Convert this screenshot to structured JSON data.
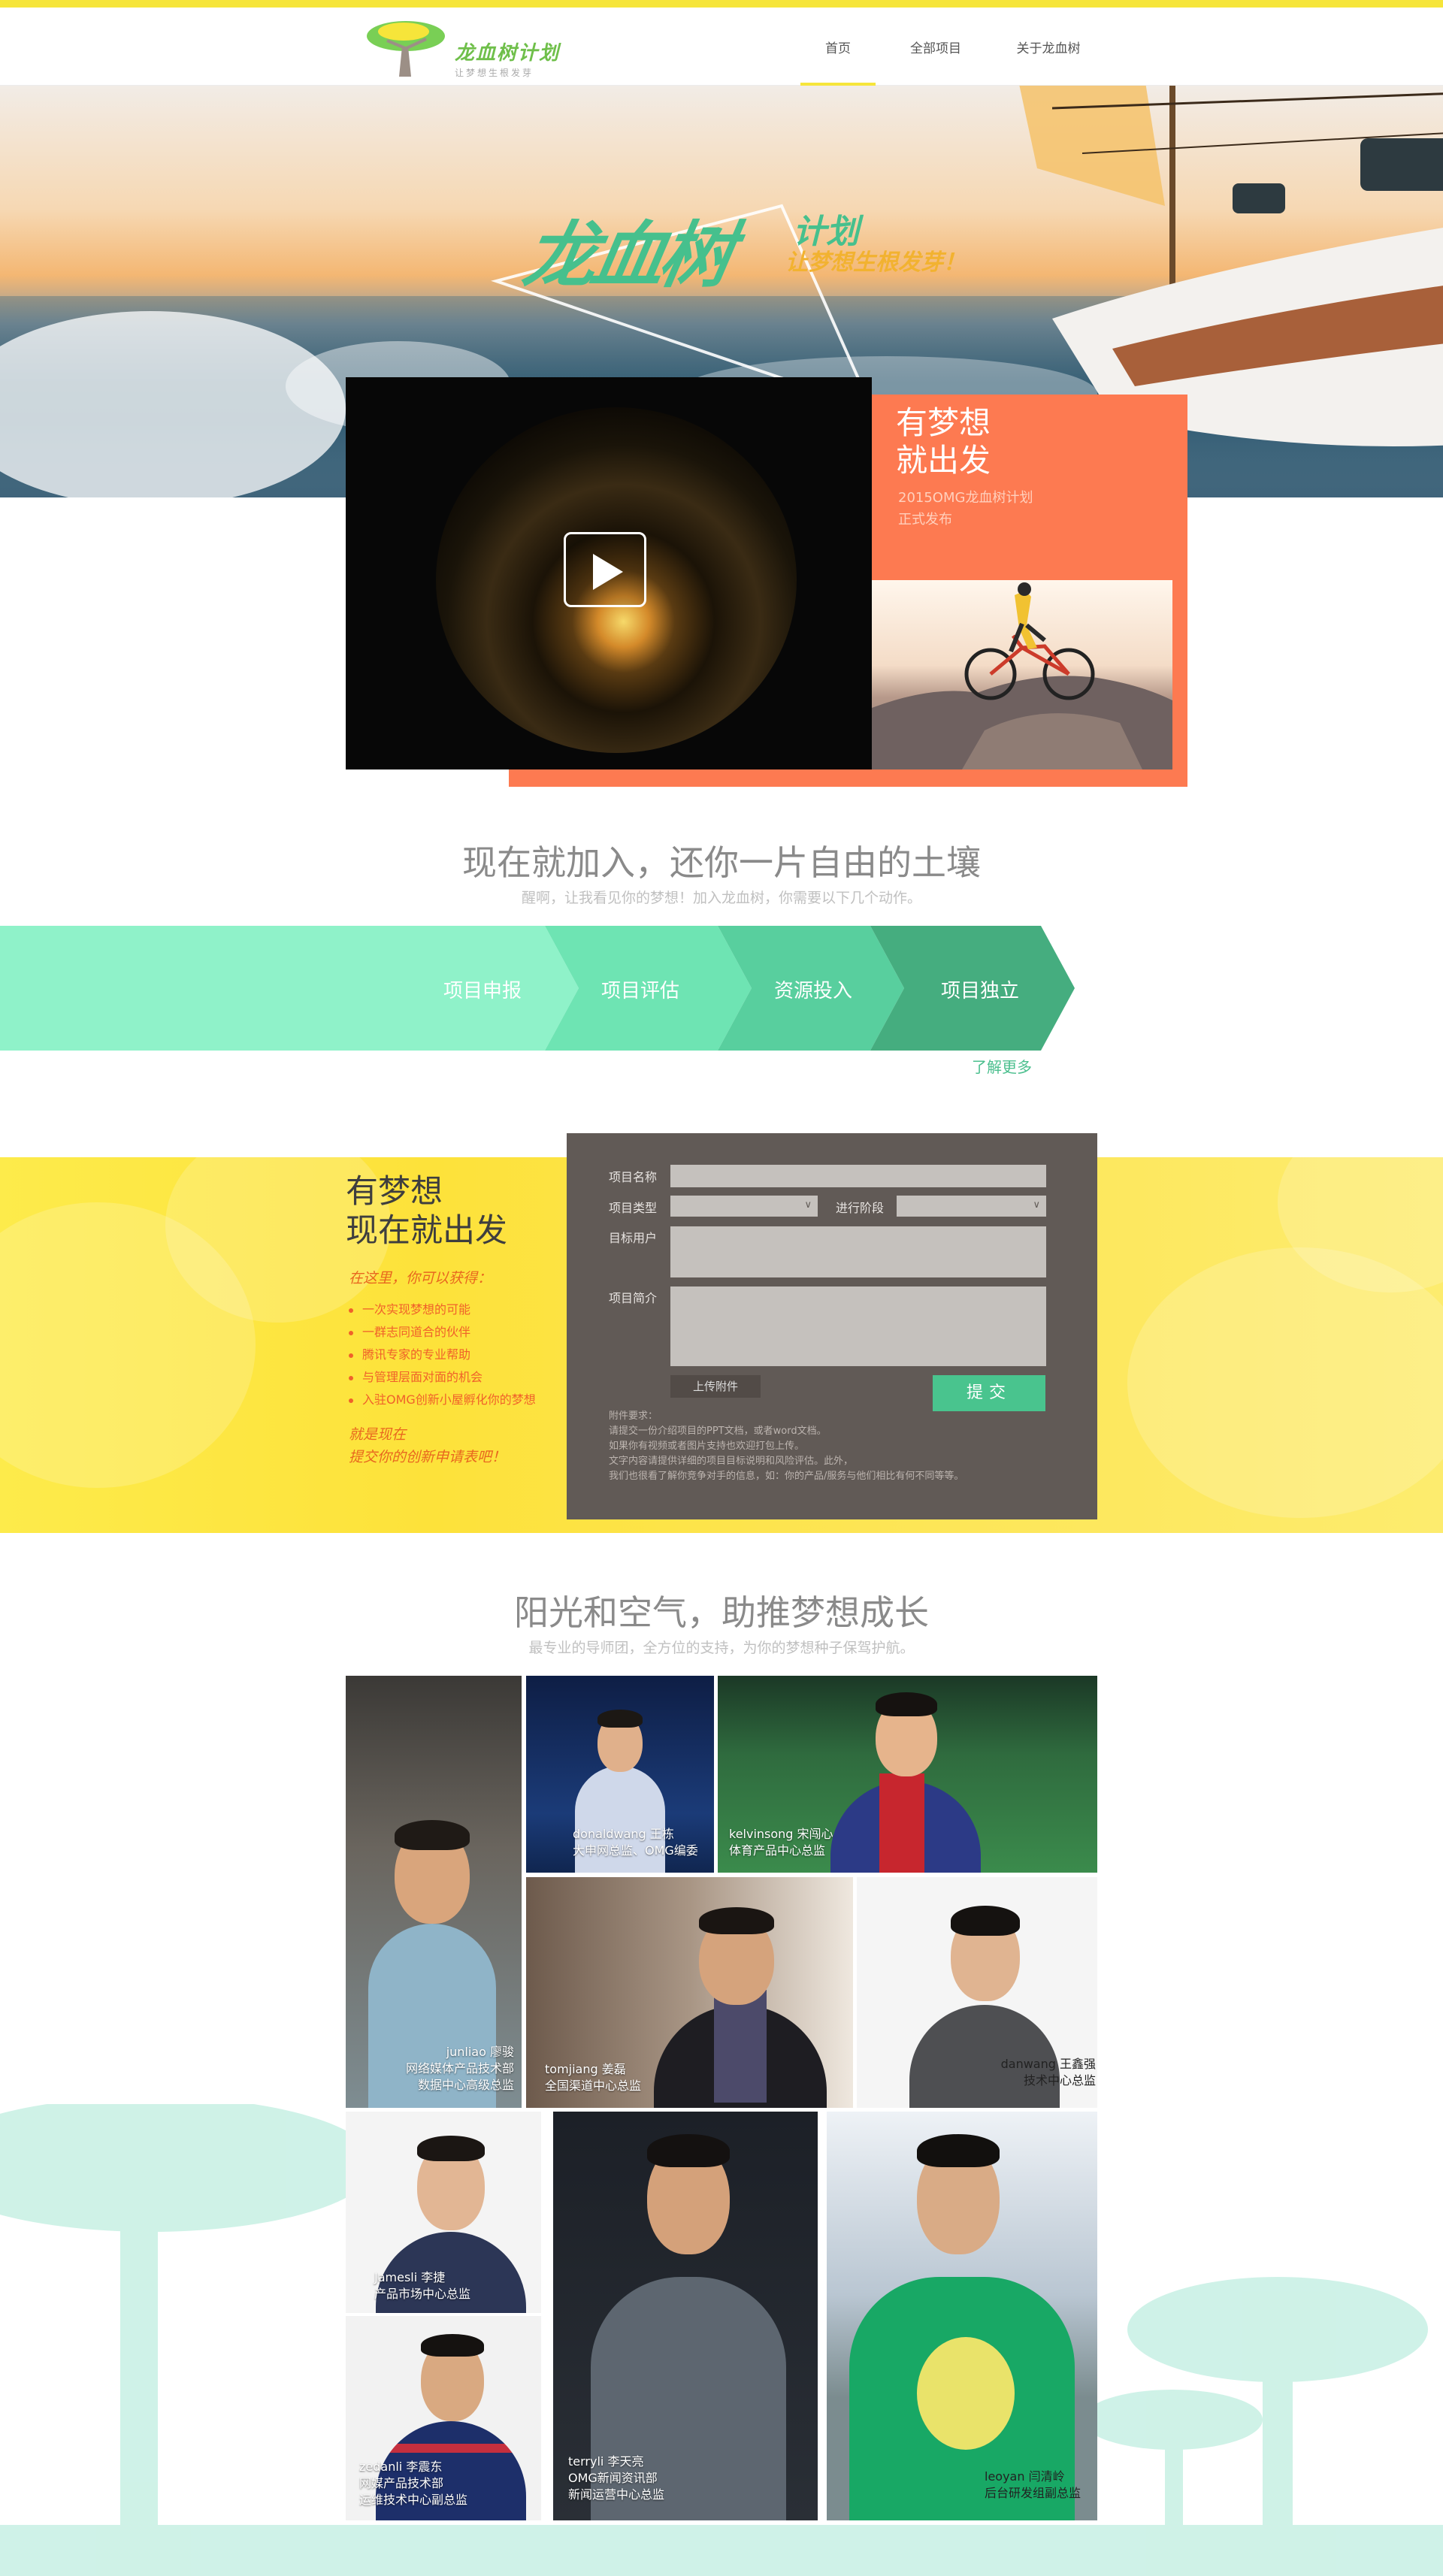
{
  "brand": {
    "name": "龙血树计划",
    "tagline": "让梦想生根发芽",
    "accent": "#f6e53a",
    "green": "#46c08d",
    "orange": "#fd7a51"
  },
  "nav": {
    "items": [
      {
        "label": "首页",
        "active": true
      },
      {
        "label": "全部项目",
        "active": false
      },
      {
        "label": "关于龙血树",
        "active": false
      }
    ]
  },
  "hero": {
    "title_main": "龙血树",
    "title_small": "计划",
    "slogan": "让梦想生根发芽！"
  },
  "feature": {
    "title_line1": "有梦想",
    "title_line2": "就出发",
    "sub_line1": "2015OMG龙血树计划",
    "sub_line2": "正式发布",
    "play_icon": "play-icon"
  },
  "join": {
    "title": "现在就加入，还你一片自由的土壤",
    "subtitle": "醒啊，让我看见你的梦想！加入龙血树，你需要以下几个动作。",
    "steps": [
      "项目申报",
      "项目评估",
      "资源投入",
      "项目独立"
    ],
    "step_colors": [
      "#8ff2c9",
      "#6ee4b3",
      "#58cf9e",
      "#45ad7f"
    ],
    "learn_more": "了解更多"
  },
  "apply": {
    "title_line1": "有梦想",
    "title_line2": "现在就出发",
    "note": "在这里，你可以获得：",
    "benefits": [
      "一次实现梦想的可能",
      "一群志同道合的伙伴",
      "腾讯专家的专业帮助",
      "与管理层面对面的机会",
      "入驻OMG创新小屋孵化你的梦想"
    ],
    "cta_line1": "就是现在",
    "cta_line2": "提交你的创新申请表吧！"
  },
  "form": {
    "name_label": "项目名称",
    "type_label": "项目类型",
    "stage_label": "进行阶段",
    "users_label": "目标用户",
    "intro_label": "项目简介",
    "name_value": "",
    "type_value": "",
    "stage_value": "",
    "users_value": "",
    "intro_value": "",
    "upload_label": "上传附件",
    "submit_label": "提交",
    "requirements": [
      "附件要求：",
      "请提交一份介绍项目的PPT文档，或者word文档。",
      "如果你有视频或者图片支持也欢迎打包上传。",
      "文字内容请提供详细的项目目标说明和风险评估。此外，",
      "我们也很看了解你竞争对手的信息，如：你的产品/服务与他们相比有何不同等等。"
    ]
  },
  "mentors": {
    "title": "阳光和空气，助推梦想成长",
    "subtitle": "最专业的导师团，全方位的支持，为你的梦想种子保驾护航。",
    "people": [
      {
        "key": "junliao",
        "lines": [
          "junliao 廖骏",
          "网络媒体产品技术部",
          "数据中心高级总监"
        ]
      },
      {
        "key": "donaldwang",
        "lines": [
          "donaldwang 王栋",
          "大申网总监、OMG编委"
        ]
      },
      {
        "key": "kelvinsong",
        "lines": [
          "kelvinsong 宋闯心",
          "体育产品中心总监"
        ]
      },
      {
        "key": "tomjiang",
        "lines": [
          "tomjiang 姜磊",
          "全国渠道中心总监"
        ]
      },
      {
        "key": "danwang",
        "lines": [
          "danwang 王鑫强",
          "技术中心总监"
        ]
      },
      {
        "key": "jamesli",
        "lines": [
          "Jamesli 李捷",
          "产品市场中心总监"
        ]
      },
      {
        "key": "terryli",
        "lines": [
          "terryli 李天亮",
          "OMG新闻资讯部",
          "新闻运营中心总监"
        ]
      },
      {
        "key": "leoyan",
        "lines": [
          "leoyan 闫清岭",
          "后台研发组副总监"
        ]
      },
      {
        "key": "zedanli",
        "lines": [
          "zedanli 李震东",
          "网媒产品技术部",
          "运维技术中心副总监"
        ]
      }
    ]
  }
}
